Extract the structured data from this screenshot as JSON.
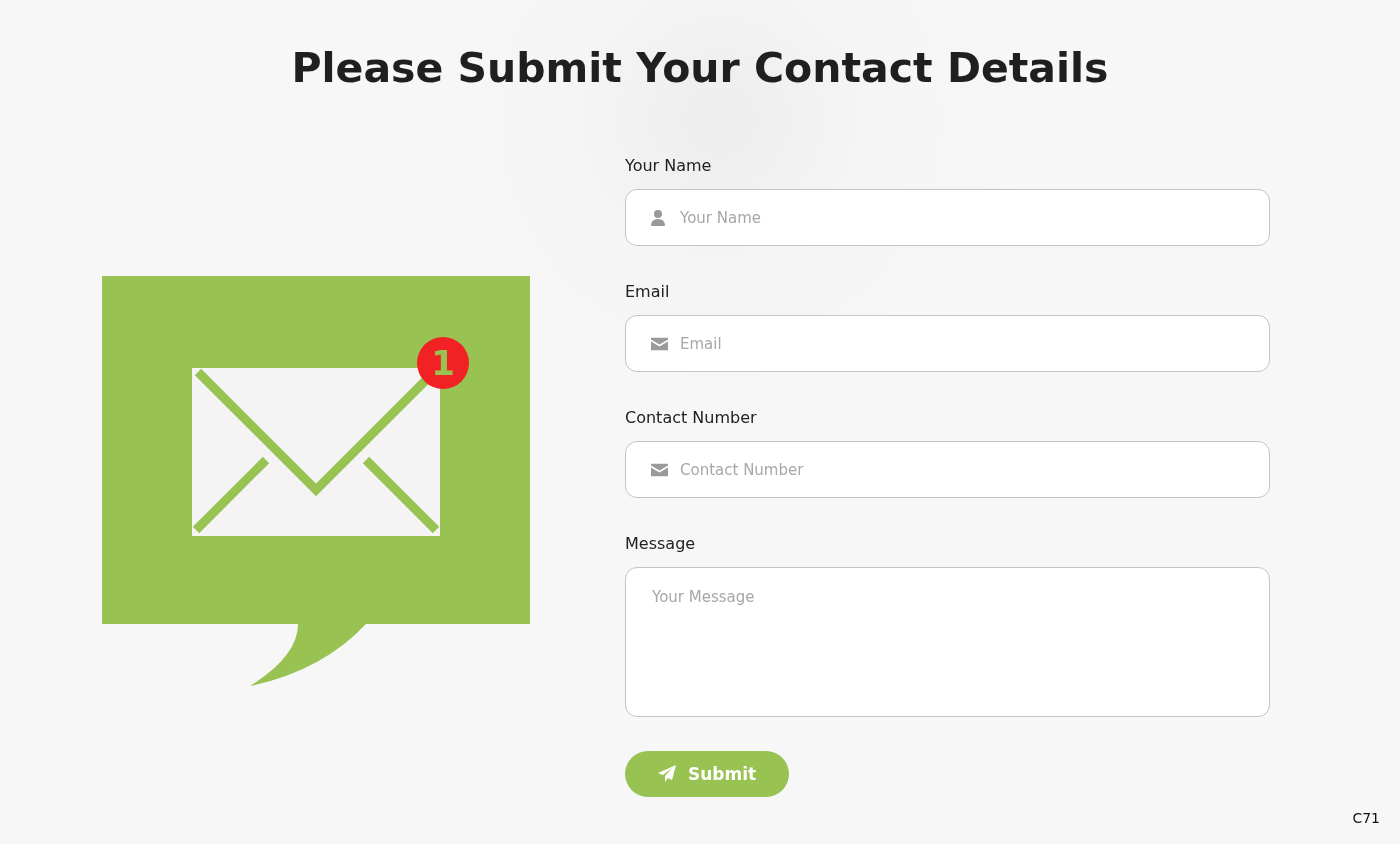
{
  "title": "Please Submit Your Contact Details",
  "illustration": {
    "badge": "1"
  },
  "fields": [
    {
      "kind": "name",
      "label": "Your Name",
      "placeholder": "Your Name"
    },
    {
      "kind": "email",
      "label": "Email",
      "placeholder": "Email"
    },
    {
      "kind": "phone",
      "label": "Contact Number",
      "placeholder": "Contact Number"
    },
    {
      "kind": "message",
      "label": "Message",
      "placeholder": "Your Message"
    }
  ],
  "submit": {
    "label": "Submit"
  },
  "footer_code": "C71"
}
